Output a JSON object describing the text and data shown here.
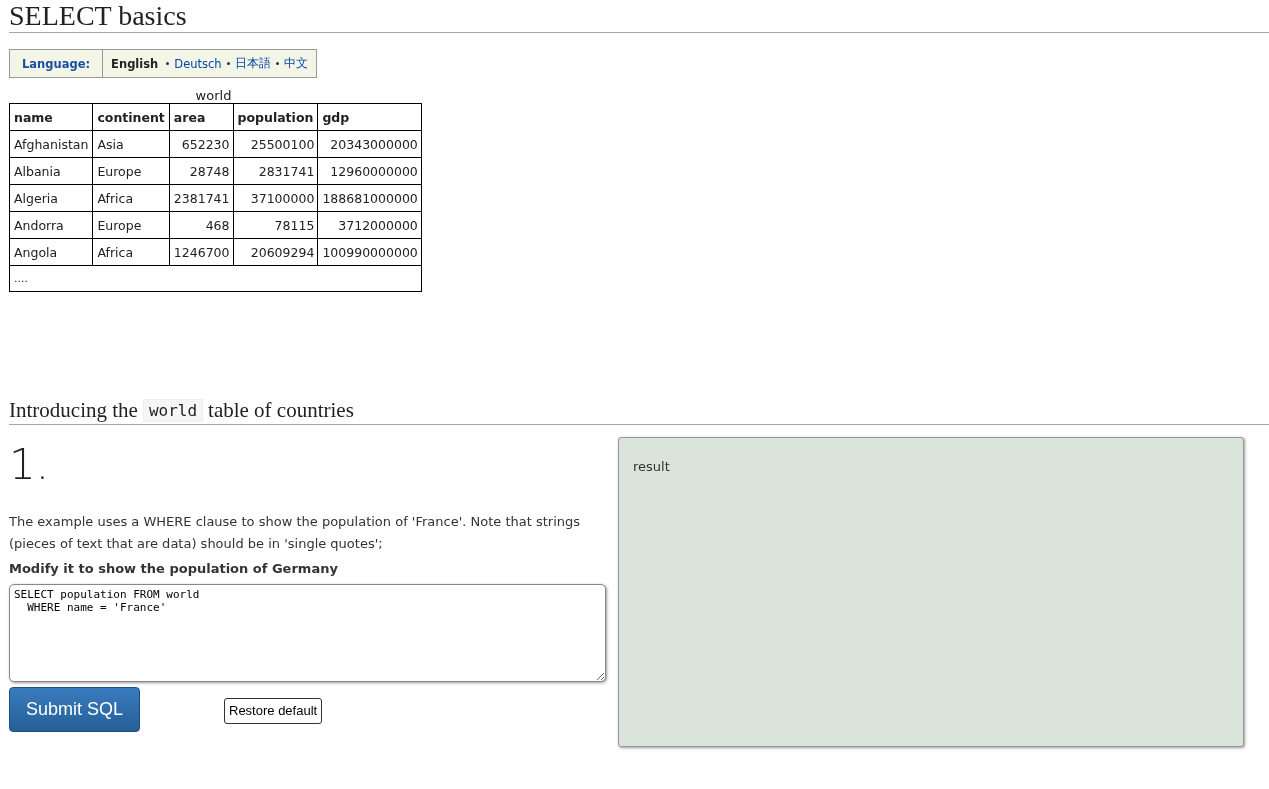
{
  "page_title": "SELECT basics",
  "language": {
    "label": "Language:",
    "options": [
      {
        "label": "English",
        "selected": true
      },
      {
        "label": "Deutsch",
        "selected": false
      },
      {
        "label": "日本語",
        "selected": false
      },
      {
        "label": "中文",
        "selected": false
      }
    ]
  },
  "table": {
    "caption": "world",
    "columns": [
      "name",
      "continent",
      "area",
      "population",
      "gdp"
    ],
    "rows": [
      [
        "Afghanistan",
        "Asia",
        "652230",
        "25500100",
        "20343000000"
      ],
      [
        "Albania",
        "Europe",
        "28748",
        "2831741",
        "12960000000"
      ],
      [
        "Algeria",
        "Africa",
        "2381741",
        "37100000",
        "188681000000"
      ],
      [
        "Andorra",
        "Europe",
        "468",
        "78115",
        "3712000000"
      ],
      [
        "Angola",
        "Africa",
        "1246700",
        "20609294",
        "100990000000"
      ]
    ],
    "more": "...."
  },
  "section": {
    "before": "Introducing the",
    "code": "world",
    "after": "table of countries"
  },
  "exercise": {
    "number": "1.",
    "description": "The example uses a WHERE clause to show the population of 'France'. Note that strings (pieces of text that are data) should be in 'single quotes';",
    "task": "Modify it to show the population of Germany",
    "sql": "SELECT population FROM world\n  WHERE name = 'France'",
    "submit": "Submit SQL",
    "restore": "Restore default",
    "result": "result"
  }
}
